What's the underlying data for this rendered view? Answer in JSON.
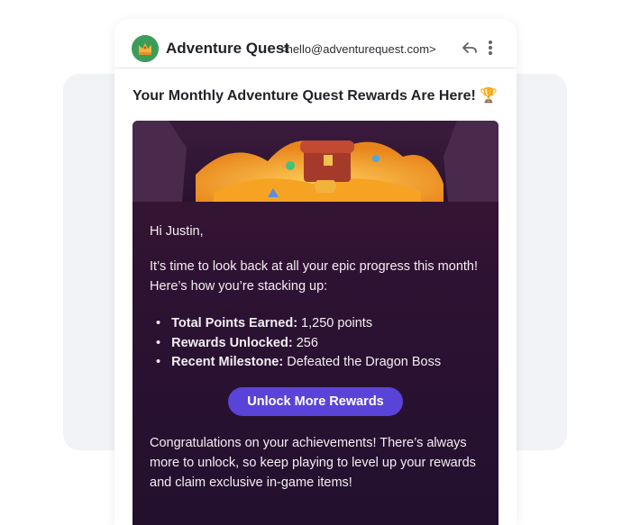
{
  "sender": {
    "name": "Adventure Quest",
    "email": "<hello@adventurequest.com>"
  },
  "icons": {
    "avatar": "crown-icon",
    "reply": "reply-icon",
    "more": "more-vertical-icon"
  },
  "subject": "Your Monthly Adventure Quest Rewards Are Here! 🏆",
  "body": {
    "greeting": "Hi Justin,",
    "intro": "It’s time to look back at all your epic progress this month! Here’s how you’re stacking up:",
    "stats": [
      {
        "label": "Total Points Earned:",
        "value": " 1,250 points"
      },
      {
        "label": "Rewards Unlocked:",
        "value": " 256"
      },
      {
        "label": "Recent Milestone:",
        "value": " Defeated the Dragon Boss"
      }
    ],
    "cta_label": "Unlock More Rewards",
    "outro": "Congratulations on your achievements! There’s always more to unlock, so keep playing to level up your rewards and claim exclusive in-game items!"
  },
  "colors": {
    "cta": "#5a43d8",
    "body_bg": "#2e1233",
    "avatar_bg": "#3c9c5a"
  }
}
